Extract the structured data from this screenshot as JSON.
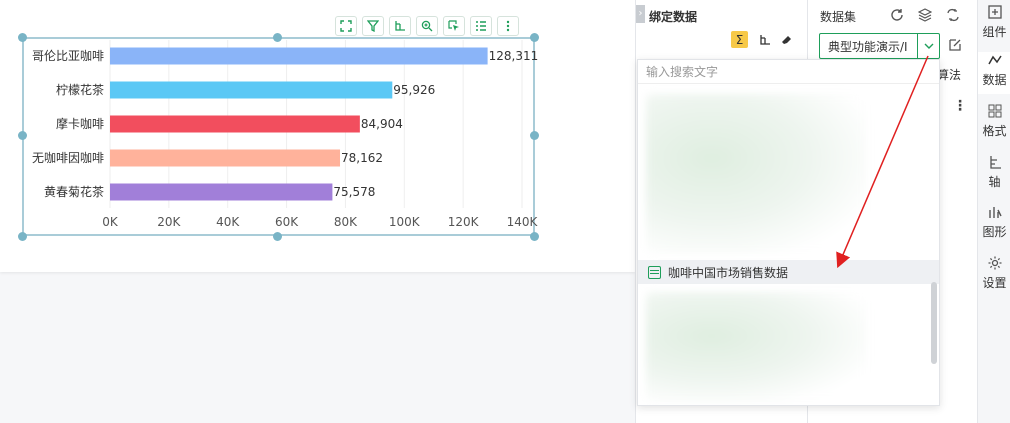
{
  "chart_toolbar": {
    "icons": [
      "fullscreen-icon",
      "filter-icon",
      "axis-swap-icon",
      "zoom-in-icon",
      "select-icon",
      "list-icon",
      "more-icon"
    ]
  },
  "chart_data": {
    "type": "bar",
    "orientation": "horizontal",
    "categories": [
      "哥伦比亚咖啡",
      "柠檬花茶",
      "摩卡咖啡",
      "无咖啡因咖啡",
      "黄春菊花茶"
    ],
    "values": [
      128311,
      95926,
      84904,
      78162,
      75578
    ],
    "value_labels": [
      "128,311",
      "95,926",
      "84,904",
      "78,162",
      "75,578"
    ],
    "colors": [
      "#8ab4f8",
      "#5bc8f5",
      "#f24e5e",
      "#ffb29b",
      "#a17fd9"
    ],
    "xlim": [
      0,
      140000
    ],
    "xticks": [
      "0K",
      "20K",
      "40K",
      "60K",
      "80K",
      "100K",
      "120K",
      "140K"
    ],
    "grid": "vertical",
    "title": "",
    "xlabel": "",
    "ylabel": ""
  },
  "bind_panel": {
    "title": "绑定数据",
    "tools": [
      "sum-icon",
      "axis-swap-icon",
      "eraser-icon"
    ]
  },
  "dataset_panel": {
    "title": "数据集",
    "icons": [
      "refresh-icon",
      "layers-icon",
      "switch-icon"
    ],
    "selected": "典型功能演示/I",
    "algo_label": "算法"
  },
  "dropdown": {
    "search_placeholder": "输入搜索文字",
    "item_label": "咖啡中国市场销售数据"
  },
  "right_rail": {
    "items": [
      {
        "label": "组件",
        "icon": "component-icon"
      },
      {
        "label": "数据",
        "icon": "data-icon"
      },
      {
        "label": "格式",
        "icon": "format-icon"
      },
      {
        "label": "轴",
        "icon": "axis-icon"
      },
      {
        "label": "图形",
        "icon": "graph-icon"
      },
      {
        "label": "设置",
        "icon": "settings-icon"
      }
    ],
    "active": "数据"
  },
  "colors": {
    "accent": "#1e9e5a",
    "arrow": "#e02020",
    "frame": "#a9ccd8"
  }
}
